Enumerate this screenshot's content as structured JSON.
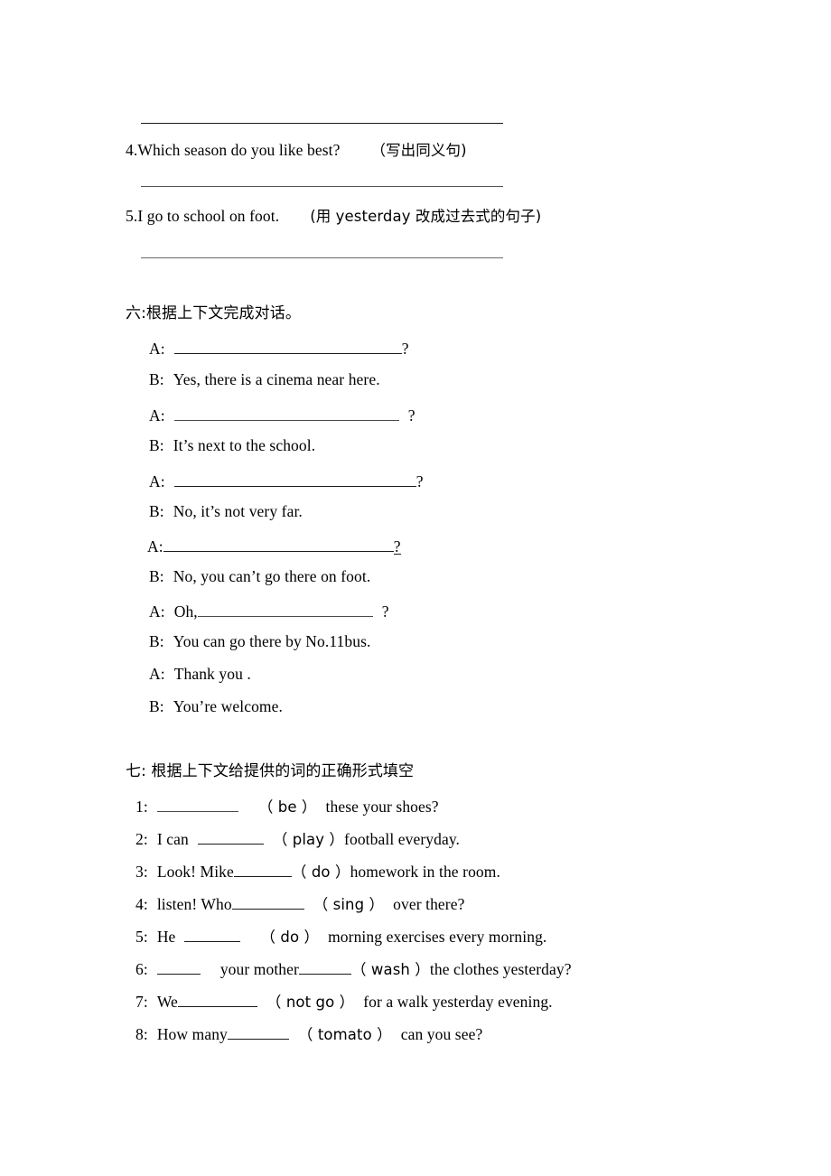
{
  "document": {
    "type": "worksheet",
    "language": "English / Chinese",
    "page_background": "#ffffff",
    "text_color": "#000000"
  },
  "top_answers": {
    "rule_before_q4": "",
    "rule_after_q4": "",
    "rule_after_q5": ""
  },
  "questions": [
    {
      "number": "4.",
      "sentence": "Which season do you like best?",
      "instruction": "（写出同义句)"
    },
    {
      "number": "5.",
      "sentence": "I go to school on foot.",
      "instruction": "(用 yesterday 改成过去式的句子)"
    }
  ],
  "section_six": {
    "heading": "六:根据上下文完成对话。",
    "lines": [
      {
        "speaker": "A:",
        "before": "",
        "blank": true,
        "after": "?"
      },
      {
        "speaker": "B:",
        "before": "Yes, there is a cinema near here.",
        "blank": false,
        "after": ""
      },
      {
        "speaker": "A:",
        "before": "",
        "blank": true,
        "after": "?"
      },
      {
        "speaker": "B:",
        "before": "It’s    next to the school.",
        "blank": false,
        "after": ""
      },
      {
        "speaker": "A:",
        "before": "",
        "blank": true,
        "after": "?"
      },
      {
        "speaker": "B:",
        "before": "No, it’s not very far.",
        "blank": false,
        "after": ""
      },
      {
        "speaker": "A:",
        "before": "",
        "blank": true,
        "after": "?"
      },
      {
        "speaker": "B:",
        "before": "No, you can’t    go there on foot.",
        "blank": false,
        "after": ""
      },
      {
        "speaker": "A:",
        "before": "Oh,",
        "blank": true,
        "after": "?"
      },
      {
        "speaker": "B:",
        "before": "You can go there by No.11bus.",
        "blank": false,
        "after": ""
      },
      {
        "speaker": "A:",
        "before": "Thank you .",
        "blank": false,
        "after": ""
      },
      {
        "speaker": "B:",
        "before": "You’re welcome.",
        "blank": false,
        "after": ""
      }
    ]
  },
  "section_seven": {
    "heading": "七: 根据上下文给提供的词的正确形式填空",
    "items": [
      {
        "number": "1:",
        "pre": "",
        "cue": "（ be ）",
        "post": "these your shoes?"
      },
      {
        "number": "2:",
        "pre": "I can",
        "cue": "（ play ）",
        "post": "football everyday."
      },
      {
        "number": "3:",
        "pre": "Look!   Mike",
        "cue": "（ do ）",
        "post": "homework in the room."
      },
      {
        "number": "4:",
        "pre": "listen! Who",
        "cue": "（ sing ）",
        "post": "over there?"
      },
      {
        "number": "5:",
        "pre": "He",
        "cue": "（ do ）",
        "post": "morning exercises every morning."
      },
      {
        "number": "6:",
        "pre": "your mother",
        "cue": "（ wash ）",
        "post": "the clothes yesterday?"
      },
      {
        "number": "7:",
        "pre": "We",
        "cue": "（ not go ）",
        "post": "for a walk yesterday   evening."
      },
      {
        "number": "8:",
        "pre": "How many",
        "cue": "（ tomato ）",
        "post": "can you see?"
      }
    ]
  }
}
